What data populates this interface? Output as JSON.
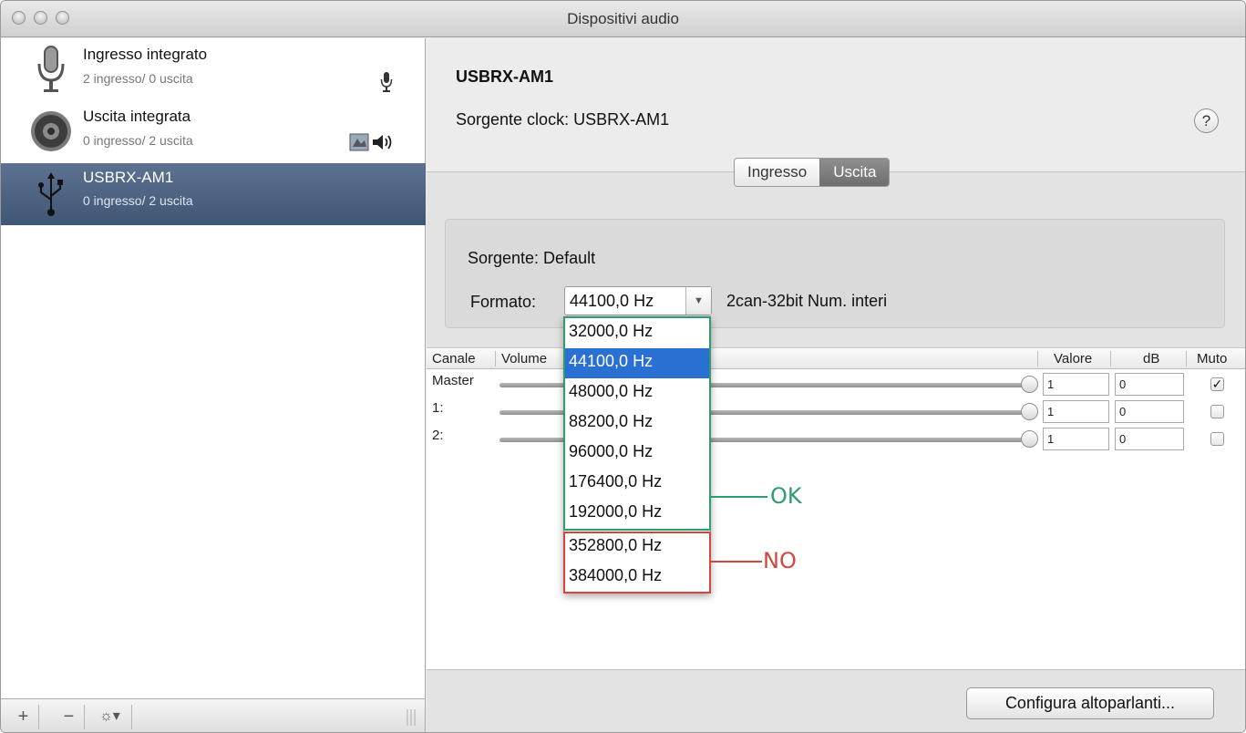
{
  "window": {
    "title": "Dispositivi audio"
  },
  "sidebar": {
    "devices": [
      {
        "name": "Ingresso integrato",
        "io": "2 ingresso/ 0 uscita",
        "icon": "microphone-icon",
        "status_icons": [
          "microphone-small-icon"
        ]
      },
      {
        "name": "Uscita integrata",
        "io": "0 ingresso/ 2 uscita",
        "icon": "speaker-icon",
        "status_icons": [
          "finder-icon",
          "speaker-small-icon"
        ]
      },
      {
        "name": "USBRX-AM1",
        "io": "0 ingresso/ 2 uscita",
        "icon": "usb-icon",
        "selected": true
      }
    ],
    "toolbar": {
      "add": "+",
      "remove": "−",
      "gear": "☼▾"
    }
  },
  "main": {
    "device_title": "USBRX-AM1",
    "clock_source": "Sorgente clock:  USBRX-AM1",
    "help": "?",
    "tabs": [
      {
        "label": "Ingresso",
        "active": false
      },
      {
        "label": "Uscita",
        "active": true
      }
    ],
    "source_label": "Sorgente:  Default",
    "format_label": "Formato:",
    "format_value": "44100,0 Hz",
    "format_desc": "2can-32bit Num. interi",
    "table": {
      "headers": [
        "Canale",
        "Volume",
        "Valore",
        "dB",
        "Muto"
      ],
      "rows": [
        {
          "channel": "Master",
          "value": "1",
          "db": "0",
          "mute": true
        },
        {
          "channel": "1:",
          "value": "1",
          "db": "0",
          "mute": false
        },
        {
          "channel": "2:",
          "value": "1",
          "db": "0",
          "mute": false
        }
      ]
    },
    "configure_button": "Configura altoparlanti..."
  },
  "format_menu": {
    "options": [
      "32000,0 Hz",
      "44100,0 Hz",
      "48000,0 Hz",
      "88200,0 Hz",
      "96000,0 Hz",
      "176400,0 Hz",
      "192000,0 Hz",
      "352800,0 Hz",
      "384000,0 Hz"
    ],
    "selected": "44100,0 Hz"
  },
  "annotations": {
    "ok": "OK",
    "no": "NO",
    "ok_color": "#2e9c6c",
    "no_color": "#d1473f"
  },
  "colors": {
    "selection": "#2a6fd2",
    "sidebar_selected": "#4a6080"
  }
}
